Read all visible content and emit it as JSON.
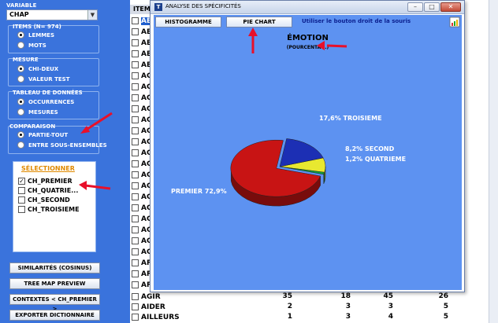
{
  "left_panel": {
    "variable_label": "VARIABLE",
    "variable_value": "CHAP",
    "items_label": "ITEMS (N= 974)",
    "items_options": [
      "LEMMES",
      "MOTS"
    ],
    "mesure_label": "MESURE",
    "mesure_options": [
      "CHI-DEUX",
      "VALEUR TEST"
    ],
    "tableau_label": "TABLEAU DE DONNÉES",
    "tableau_options": [
      "OCCURRENCES",
      "MESURES"
    ],
    "comparaison_label": "COMPARAISON",
    "comparaison_options": [
      "PARTIE-TOUT",
      "ENTRE SOUS-ENSEMBLES"
    ],
    "selection_title": "SÉLECTIONNER",
    "selection_items": [
      {
        "label": "CH_PREMIER",
        "checked": true
      },
      {
        "label": "CH_QUATRIE...",
        "checked": false
      },
      {
        "label": "CH_SECOND",
        "checked": false
      },
      {
        "label": "CH_TROISIEME",
        "checked": false
      }
    ],
    "buttons": {
      "similarites": "SIMILARITÉS (COSINUS)",
      "treemap": "TREE MAP PREVIEW",
      "contextes": "CONTEXTES  < CH_PREMIER >",
      "exporter": "EXPORTER DICTIONNAIRE"
    }
  },
  "table": {
    "header": "ITEM",
    "partial_rows": [
      "AB",
      "AB",
      "AB",
      "AB",
      "AB",
      "AC",
      "AC",
      "AC",
      "AC",
      "AC",
      "AC",
      "AC",
      "AC",
      "AC",
      "AC",
      "AC",
      "AC",
      "AC",
      "AC",
      "AC",
      "AC",
      "AC",
      "AF",
      "AF",
      "AF"
    ],
    "rows": [
      {
        "item": "AGIR",
        "values": [
          "35",
          "18",
          "45",
          "26"
        ]
      },
      {
        "item": "AIDER",
        "values": [
          "2",
          "3",
          "3",
          "5"
        ]
      },
      {
        "item": "AILLEURS",
        "values": [
          "1",
          "3",
          "4",
          "5"
        ]
      }
    ]
  },
  "dialog": {
    "title": "ANALYSE DES SPÉCIFICITÉS",
    "app_icon_letter": "T",
    "btn_histogramme": "HISTOGRAMME",
    "btn_pie_chart": "PIE CHART",
    "hint": "Utiliser le bouton droit de la souris",
    "window_controls": {
      "minimize": "–",
      "maximize": "□",
      "close": "✕"
    }
  },
  "chart_data": {
    "type": "pie",
    "title": "ÉMOTION",
    "subtitle": "(POURCENTAG.)",
    "slices": [
      {
        "label": "PREMIER",
        "value": 72.9,
        "display": "PREMIER  72,9%",
        "color": "#c81414"
      },
      {
        "label": "QUATRIEME",
        "value": 1.2,
        "display": "1,2%  QUATRIEME",
        "color": "#12a03a"
      },
      {
        "label": "SECOND",
        "value": 8.2,
        "display": "8,2%  SECOND",
        "color": "#e8e830"
      },
      {
        "label": "TROISIEME",
        "value": 17.6,
        "display": "17,6%  TROISIEME",
        "color": "#1c2fb4"
      }
    ],
    "exploded": "PREMIER",
    "style": "3d"
  }
}
